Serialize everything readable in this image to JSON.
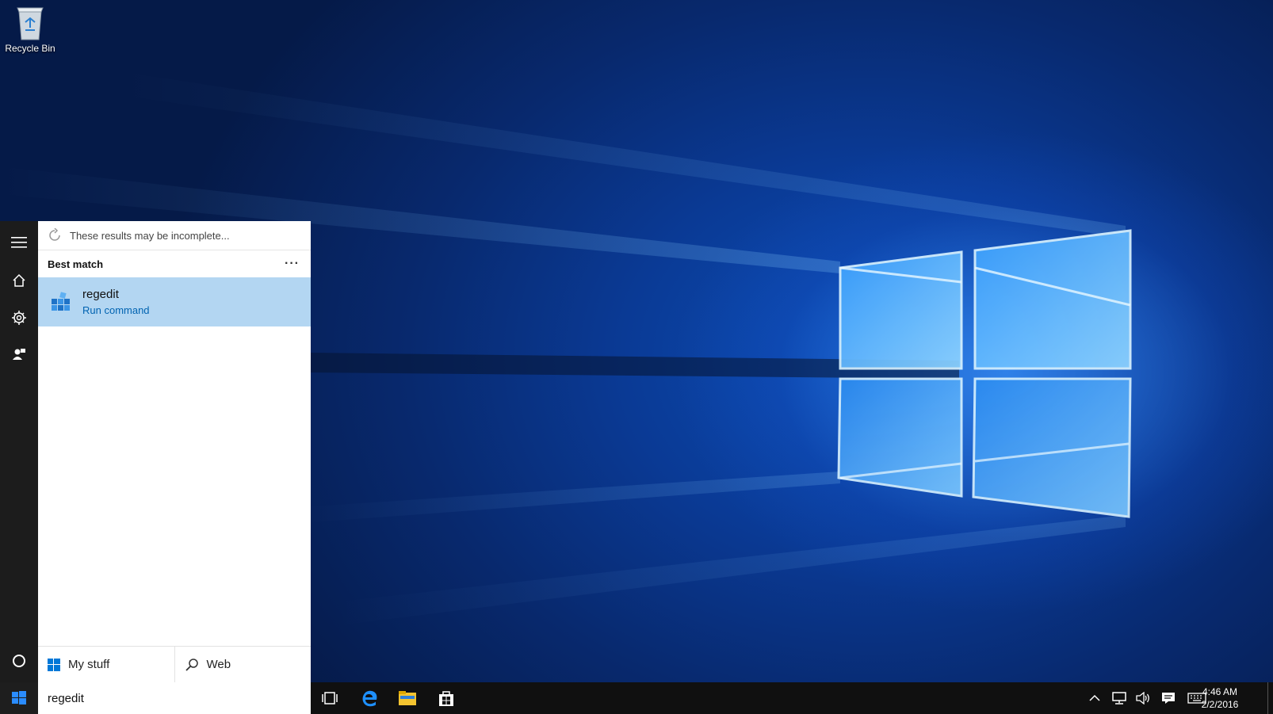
{
  "desktop": {
    "icons": [
      {
        "label": "Recycle Bin",
        "icon": "recycle-bin-icon"
      }
    ]
  },
  "start_rail": {
    "items": [
      "menu-icon",
      "home-icon",
      "settings-icon",
      "feedback-icon",
      "cortana-circle-icon"
    ]
  },
  "search_panel": {
    "notice": "These results may be incomplete...",
    "section_title": "Best match",
    "more_label": "···",
    "best_match": {
      "title": "regedit",
      "subtitle": "Run command",
      "icon": "regedit-icon"
    },
    "scope_buttons": [
      {
        "label": "My stuff",
        "icon": "windows-logo-icon"
      },
      {
        "label": "Web",
        "icon": "search-icon"
      }
    ]
  },
  "taskbar": {
    "search_value": "regedit",
    "pinned": [
      "task-view-icon",
      "edge-icon",
      "file-explorer-icon",
      "store-icon"
    ],
    "tray": [
      "show-hidden-icons-chevron",
      "network-icon",
      "volume-icon",
      "action-center-icon",
      "touch-keyboard-icon"
    ],
    "time": "4:46 AM",
    "date": "2/2/2016"
  },
  "colors": {
    "selection": "#b3d6f2",
    "accent": "#0063b1",
    "rail": "#1c1c1c",
    "taskbar": "#101010"
  }
}
